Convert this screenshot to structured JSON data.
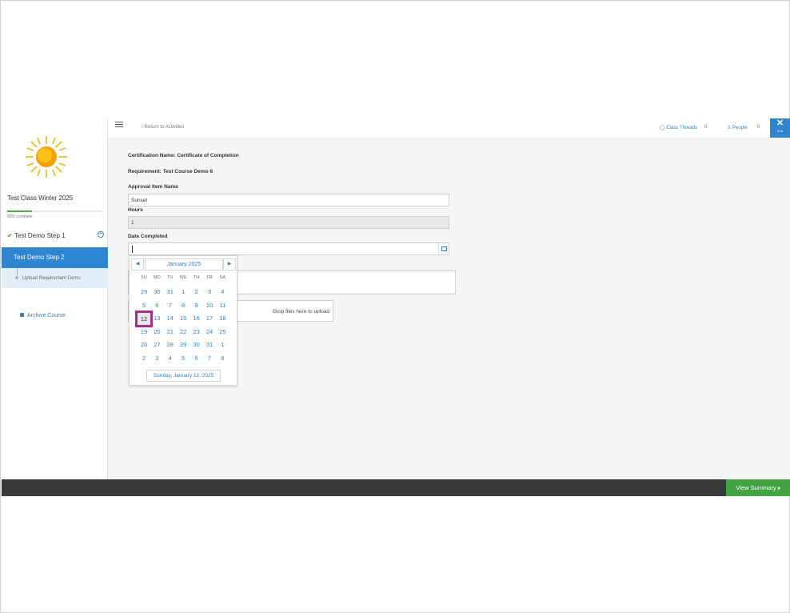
{
  "sidebar": {
    "course_title": "Test Class Winter 2025",
    "progress_percent": 50,
    "progress_text": "50% complete",
    "steps": [
      {
        "label": "Test Demo Step 1",
        "completed": true
      },
      {
        "label": "Test Demo Step 2",
        "active": true
      }
    ],
    "substep_label": "Upload Requirement Demo",
    "archive_label": "Archive Course"
  },
  "topbar": {
    "return_label": "Return to Activities",
    "threads_label": "Class Threads",
    "threads_count": "0",
    "people_label": "People",
    "people_count": "0",
    "exit_label": "Exit"
  },
  "form": {
    "certification": "Certification Name: Certificate of Completion",
    "requirement": "Requirement: Test Course Demo 6",
    "approval_label": "Approval Item Name",
    "approval_value": "Sunset",
    "hours_label": "Hours",
    "hours_value": "1",
    "date_label": "Date Completed",
    "date_value": "",
    "dropzone_text": "Drop files here to upload"
  },
  "datepicker": {
    "month_title": "January 2025",
    "weekdays": [
      "SU",
      "MO",
      "TU",
      "WE",
      "TH",
      "FR",
      "SA"
    ],
    "weeks": [
      [
        "29",
        "30",
        "31",
        "1",
        "2",
        "3",
        "4"
      ],
      [
        "5",
        "6",
        "7",
        "8",
        "9",
        "10",
        "11"
      ],
      [
        "12",
        "13",
        "14",
        "15",
        "16",
        "17",
        "18"
      ],
      [
        "19",
        "20",
        "21",
        "22",
        "23",
        "24",
        "25"
      ],
      [
        "26",
        "27",
        "28",
        "29",
        "30",
        "31",
        "1"
      ],
      [
        "2",
        "3",
        "4",
        "5",
        "6",
        "7",
        "8"
      ]
    ],
    "selected": "12",
    "today_label": "Sunday, January 12, 2025"
  },
  "footer": {
    "view_summary_label": "View Summary"
  },
  "colors": {
    "accent": "#2f85cf",
    "success": "#43a443",
    "footer_bg": "#393939",
    "selected_outline": "#a3308a"
  }
}
